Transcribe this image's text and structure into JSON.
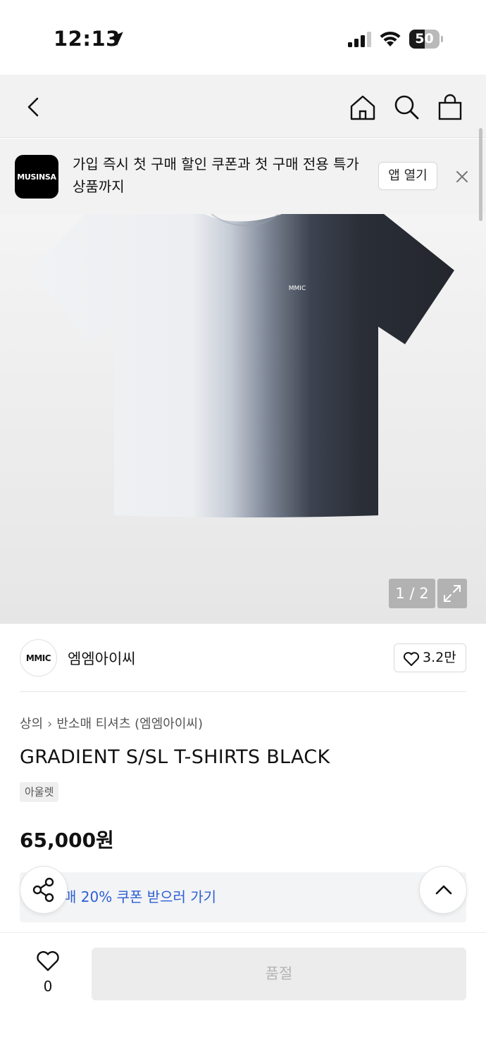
{
  "status_bar": {
    "time": "12:13",
    "battery": "50",
    "battery_level": 0.5,
    "icons": [
      "location-arrow-icon",
      "cellular-signal-icon",
      "wifi-icon",
      "battery-icon"
    ]
  },
  "nav": {
    "icons": [
      "back-chevron-icon",
      "home-icon",
      "search-icon",
      "shopping-bag-icon"
    ]
  },
  "promo": {
    "logo_text": "MUSINSA",
    "message": "가입 즉시 첫 구매 할인 쿠폰과 첫 구매 전용 특가 상품까지",
    "open_app_label": "앱 열기",
    "close_icon": "close-icon"
  },
  "gallery": {
    "counter": "1 / 2",
    "expand_icon": "expand-arrows-icon",
    "logo_text": "MMIC"
  },
  "brand": {
    "logo_text": "MMIC",
    "name": "엠엠아이씨",
    "likes": "3.2만"
  },
  "breadcrumb": {
    "category": "상의",
    "subcategory": "반소매 티셔츠 (엠엠아이씨)"
  },
  "product": {
    "title": "GRADIENT S/SL T-SHIRTS BLACK",
    "tag": "아울렛",
    "price": "65,000원"
  },
  "coupon": {
    "text": "매 20% 쿠폰 받으러 가기"
  },
  "bottom_bar": {
    "wish_count": "0",
    "buy_label": "품절"
  },
  "colors": {
    "accent_blue": "#2c5fd4",
    "soldout_bg": "#ececec",
    "soldout_text": "#b4b4b4"
  }
}
